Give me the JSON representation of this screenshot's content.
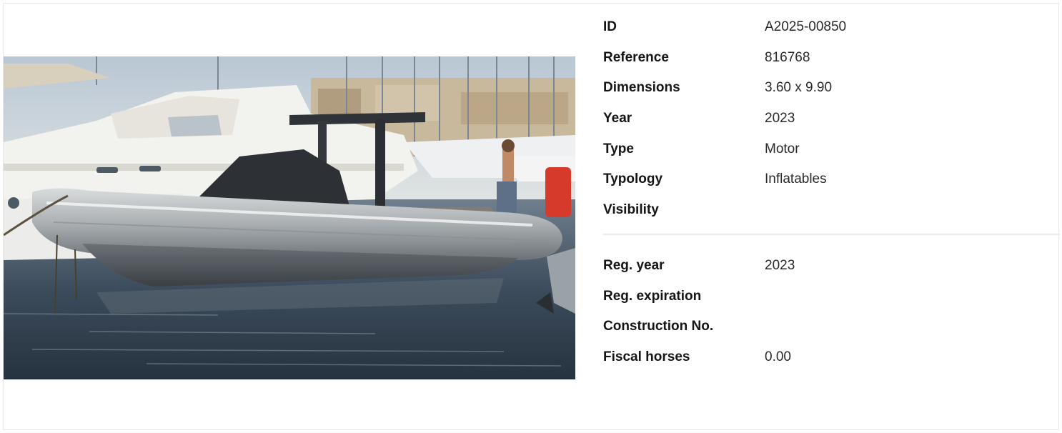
{
  "listing": {
    "photo_alt": "",
    "details": [
      {
        "label": "ID",
        "value": "A2025-00850"
      },
      {
        "label": "Reference",
        "value": "816768"
      },
      {
        "label": "Dimensions",
        "value": "3.60 x 9.90"
      },
      {
        "label": "Year",
        "value": "2023"
      },
      {
        "label": "Type",
        "value": "Motor"
      },
      {
        "label": "Typology",
        "value": "Inflatables"
      },
      {
        "label": "Visibility",
        "value": ""
      }
    ],
    "registration": [
      {
        "label": "Reg. year",
        "value": "2023"
      },
      {
        "label": "Reg. expiration",
        "value": ""
      },
      {
        "label": "Construction No.",
        "value": ""
      },
      {
        "label": "Fiscal horses",
        "value": "0.00"
      }
    ]
  },
  "colors": {
    "border": "#e7e7e7",
    "label": "#151515",
    "value": "#2a2a2a",
    "divider": "#ebebeb"
  }
}
